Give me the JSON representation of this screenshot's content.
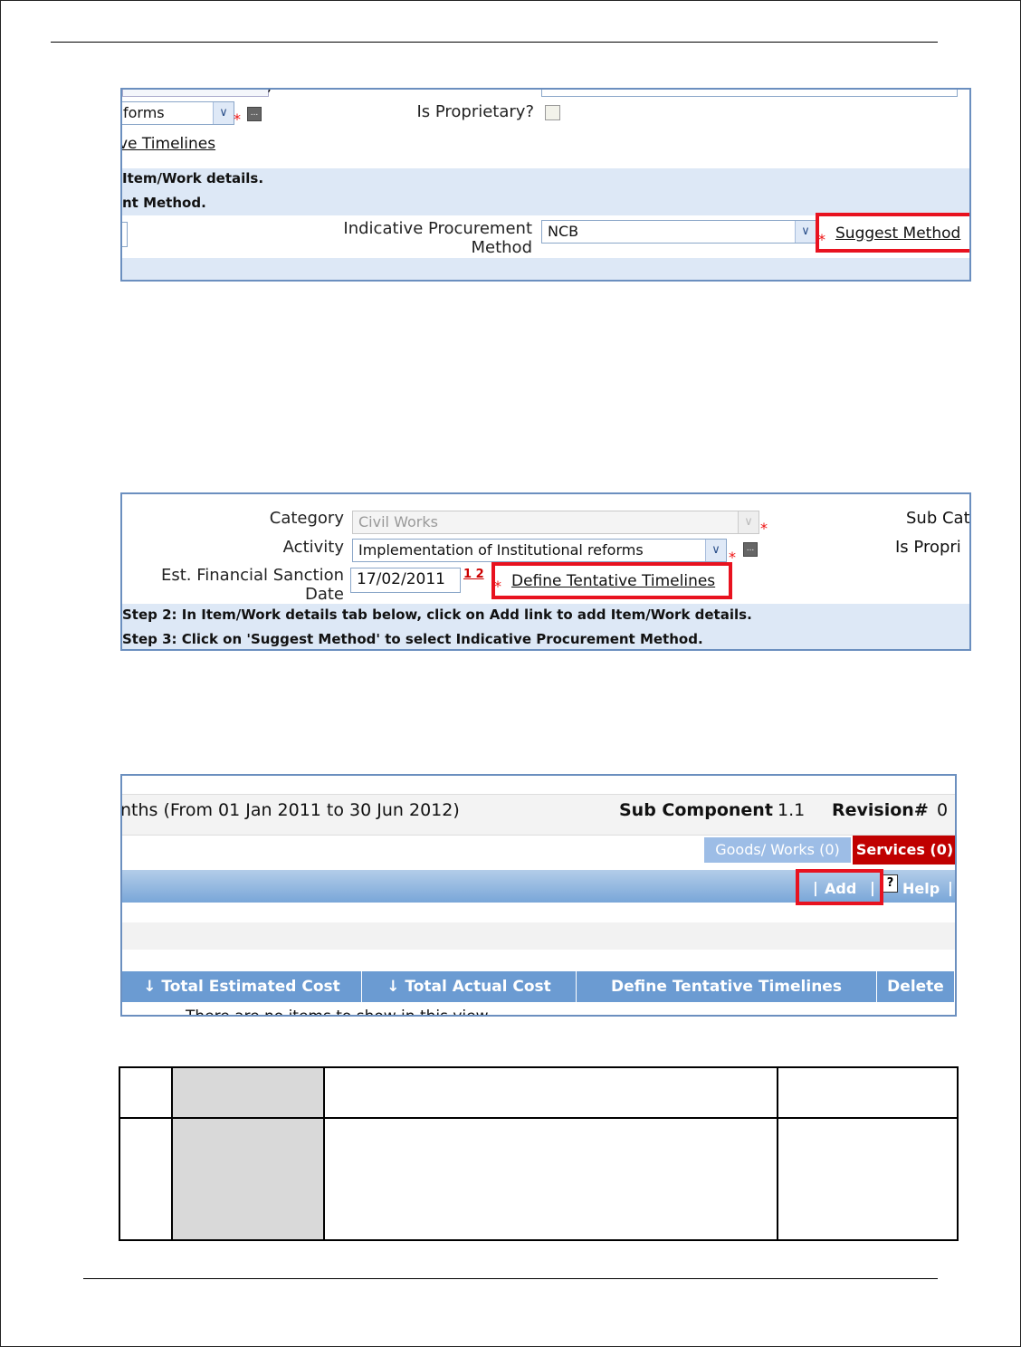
{
  "shot1": {
    "trailing_fragment": ",",
    "activity_fragment": "forms",
    "timelines_link_fragment": "ve Timelines",
    "step2_fragment": "Item/Work details.",
    "step3_fragment": "nt Method.",
    "is_proprietary_label": "Is Proprietary?",
    "method_label": "Indicative Procurement Method",
    "method_value": "NCB",
    "suggest_method_link": "Suggest Method",
    "required_marker": "*",
    "ellipsis": "..."
  },
  "shot2": {
    "category_label": "Category",
    "category_value": "Civil Works",
    "activity_label": "Activity",
    "activity_value": "Implementation of Institutional reforms",
    "sanction_label": "Est. Financial Sanction Date",
    "sanction_value": "17/02/2011",
    "date_icon_text": "1 2",
    "define_link": "Define Tentative Timelines",
    "sub_cat_fragment": "Sub Cat",
    "is_propri_fragment": "Is Propri",
    "step2": "Step 2: In Item/Work details tab below, click on Add link to add Item/Work details.",
    "step3": "Step 3: Click on 'Suggest Method' to select Indicative Procurement Method."
  },
  "shot3": {
    "period_text": "nths (From 01 Jan 2011 to 30 Jun 2012)",
    "sub_component_label": "Sub Component",
    "sub_component_value": "1.1",
    "revision_label": "Revision#",
    "revision_value": "0",
    "tab_goods": "Goods/ Works (0)",
    "tab_services": "Services (0)",
    "toolbar_sep1": "|",
    "toolbar_add": "Add",
    "toolbar_sep2": "|",
    "toolbar_help": "Help",
    "toolbar_sep3": "|",
    "columns": [
      "Total Estimated Cost",
      "Total Actual Cost",
      "Define Tentative Timelines",
      "Delete"
    ],
    "sort_arrow": "↓",
    "empty_fragment": "There are no items to show in this view."
  },
  "colors": {
    "highlight": "#e8121f",
    "band": "#dde8f6",
    "header_blue": "#6b9bd2",
    "services_tab": "#c00000"
  }
}
